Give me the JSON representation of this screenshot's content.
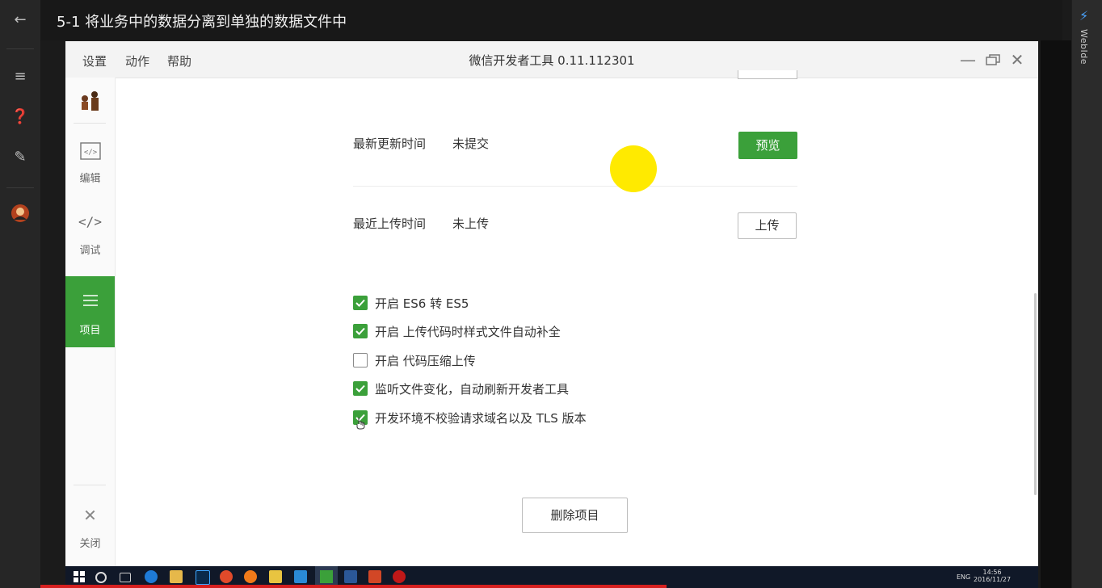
{
  "video": {
    "title": "5-1 将业务中的数据分离到单独的数据文件中",
    "side_panel_label": "WebIde"
  },
  "app": {
    "title": "微信开发者工具 0.11.112301",
    "menu": [
      "设置",
      "动作",
      "帮助"
    ]
  },
  "sidebar": {
    "items": [
      {
        "label": "编辑",
        "icon": "code-file-icon",
        "glyph": "‹/›"
      },
      {
        "label": "调试",
        "icon": "debug-code-icon",
        "glyph": "</>"
      },
      {
        "label": "项目",
        "icon": "menu-lines-icon",
        "glyph": "☰",
        "active": true
      }
    ],
    "close_label": "关闭"
  },
  "project": {
    "rows": [
      {
        "label": "最新更新时间",
        "value": "未提交",
        "button": "预览"
      },
      {
        "label": "最近上传时间",
        "value": "未上传",
        "button": "上传"
      }
    ],
    "options": [
      {
        "label": "开启 ES6 转 ES5",
        "checked": true
      },
      {
        "label": "开启 上传代码时样式文件自动补全",
        "checked": true
      },
      {
        "label": "开启 代码压缩上传",
        "checked": false
      },
      {
        "label": "监听文件变化，自动刷新开发者工具",
        "checked": true
      },
      {
        "label": "开发环境不校验请求域名以及 TLS 版本",
        "checked": true
      }
    ],
    "delete_button": "删除项目"
  },
  "taskbar": {
    "lang": "ENG",
    "time": "14:56",
    "date": "2016/11/27"
  },
  "colors": {
    "accent": "#3ba03a",
    "highlight_dot": "#ffea00"
  }
}
